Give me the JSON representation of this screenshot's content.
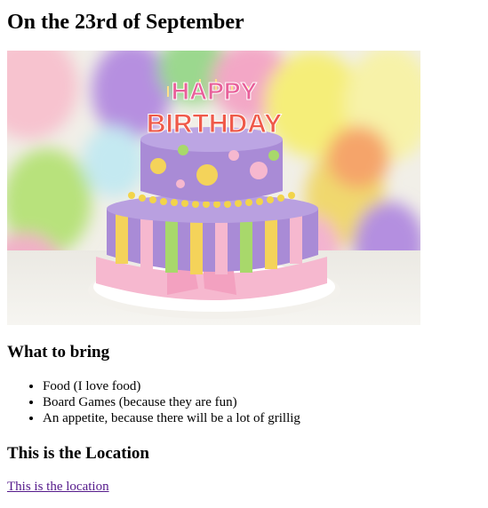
{
  "page": {
    "heading": "On the 23rd of September",
    "cake_candle_text_top": "HAPPY",
    "cake_candle_text_bottom": "BIRTHDAY",
    "bring_section": {
      "heading": "What to bring",
      "items": [
        "Food (I love food)",
        "Board Games (because they are fun)",
        "An appetite, because there will be a lot of grillig"
      ]
    },
    "location_section": {
      "heading": "This is the Location",
      "link_text": "This is the location"
    }
  },
  "colors": {
    "link_visited": "#551a8b",
    "cake_purple": "#a98bd6",
    "frosting_pink": "#f6b8cf",
    "accent_yellow": "#f4d35a",
    "accent_green": "#a8d86b"
  }
}
